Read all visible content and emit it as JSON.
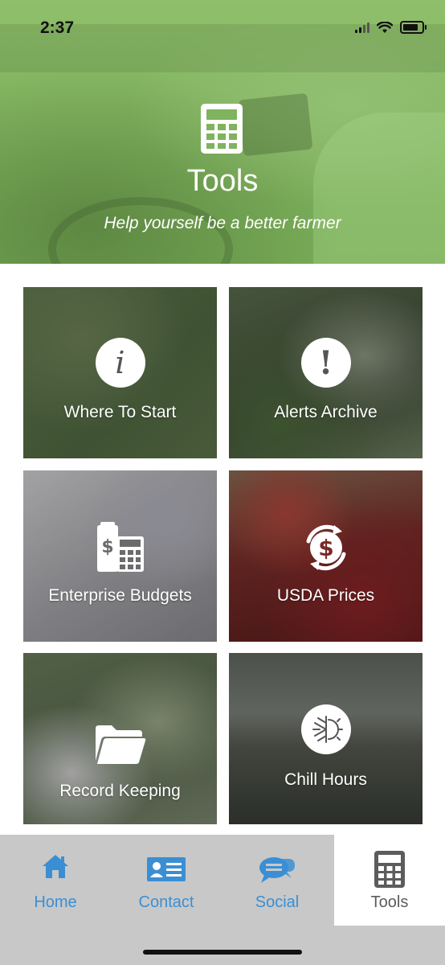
{
  "status_bar": {
    "time": "2:37"
  },
  "header": {
    "icon": "calculator-icon",
    "title": "Tools",
    "subtitle": "Help yourself be a better farmer"
  },
  "tools": [
    {
      "label": "Where To Start",
      "icon": "info-icon"
    },
    {
      "label": "Alerts Archive",
      "icon": "exclamation-icon"
    },
    {
      "label": "Enterprise Budgets",
      "icon": "budget-calculator-icon"
    },
    {
      "label": "USDA Prices",
      "icon": "dollar-refresh-icon"
    },
    {
      "label": "Record Keeping",
      "icon": "folder-icon"
    },
    {
      "label": "Chill Hours",
      "icon": "snowflake-sun-icon"
    }
  ],
  "tabbar": {
    "items": [
      {
        "label": "Home",
        "icon": "home-icon",
        "active": false
      },
      {
        "label": "Contact",
        "icon": "contact-card-icon",
        "active": false
      },
      {
        "label": "Social",
        "icon": "chat-bubbles-icon",
        "active": false
      },
      {
        "label": "Tools",
        "icon": "calculator-icon",
        "active": true
      }
    ]
  },
  "colors": {
    "accent_blue": "#3a8fd4",
    "header_green": "#7fb35d",
    "tabbar_gray": "#c8c8c8",
    "active_tab_text": "#5c5c5c"
  }
}
